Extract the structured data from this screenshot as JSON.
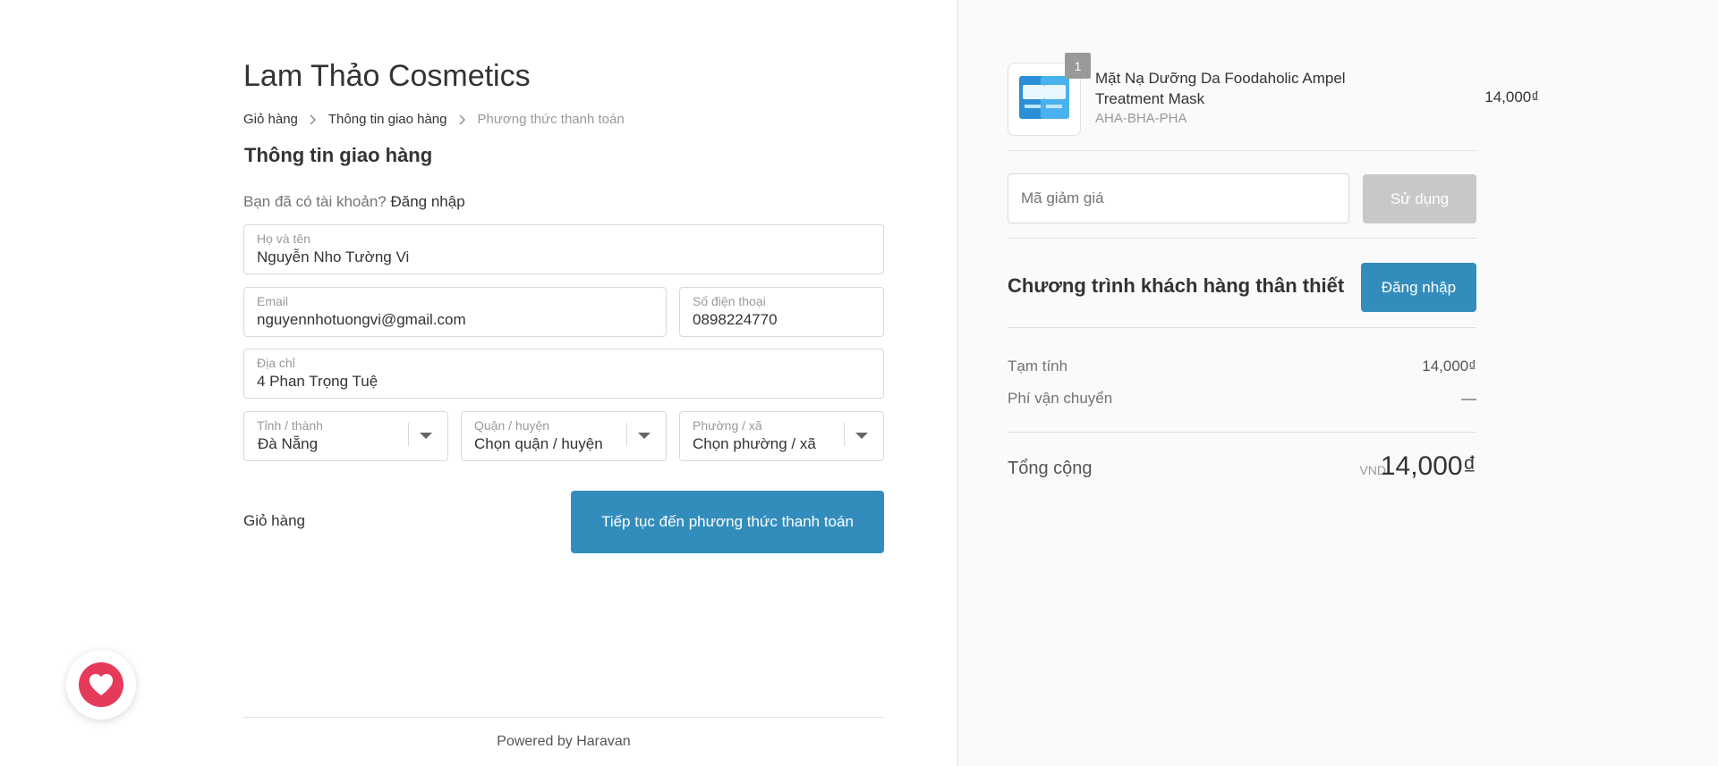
{
  "shop": {
    "name": "Lam Thảo Cosmetics"
  },
  "breadcrumb": {
    "items": [
      {
        "label": "Giỏ hàng"
      },
      {
        "label": "Thông tin giao hàng"
      },
      {
        "label": "Phương thức thanh toán"
      }
    ]
  },
  "section_title": "Thông tin giao hàng",
  "account": {
    "question": "Bạn đã có tài khoản?",
    "login_link": "Đăng nhập"
  },
  "form": {
    "fullname": {
      "label": "Họ và tên",
      "value": "Nguyễn Nho Tường Vi"
    },
    "email": {
      "label": "Email",
      "value": "nguyennhotuongvi@gmail.com"
    },
    "phone": {
      "label": "Số điện thoại",
      "value": "0898224770"
    },
    "address": {
      "label": "Địa chỉ",
      "value": "4 Phan Trọng Tuệ"
    },
    "province": {
      "label": "Tỉnh / thành",
      "value": "Đà Nẵng"
    },
    "district": {
      "label": "Quận / huyện",
      "value": "Chọn quận / huyện"
    },
    "ward": {
      "label": "Phường / xã",
      "value": "Chọn phường / xã"
    }
  },
  "actions": {
    "back_label": "Giỏ hàng",
    "continue_label": "Tiếp tục đến phương thức thanh toán"
  },
  "footer": {
    "powered_by": "Powered by Haravan"
  },
  "cart": {
    "product": {
      "quantity": "1",
      "name": "Mặt Nạ Dưỡng Da Foodaholic Ampel Treatment Mask",
      "variant": "AHA-BHA-PHA",
      "price": "14,000₫"
    },
    "discount": {
      "placeholder": "Mã giảm giá",
      "apply_label": "Sử dụng"
    },
    "loyalty": {
      "title": "Chương trình khách hàng thân thiết",
      "login_label": "Đăng nhập"
    },
    "summary": {
      "subtotal_label": "Tạm tính",
      "subtotal_value": "14,000₫",
      "shipping_label": "Phí vận chuyển",
      "shipping_value": "—",
      "total_label": "Tổng cộng",
      "total_currency": "VND",
      "total_value": "14,000₫"
    }
  },
  "colors": {
    "primary": "#338dbc",
    "disabled": "#c8c8c8",
    "favorite": "#e63a5a"
  },
  "icons": {
    "breadcrumb_separator": "chevron-right-icon",
    "select_caret": "caret-down-icon",
    "favorite": "heart-icon"
  }
}
